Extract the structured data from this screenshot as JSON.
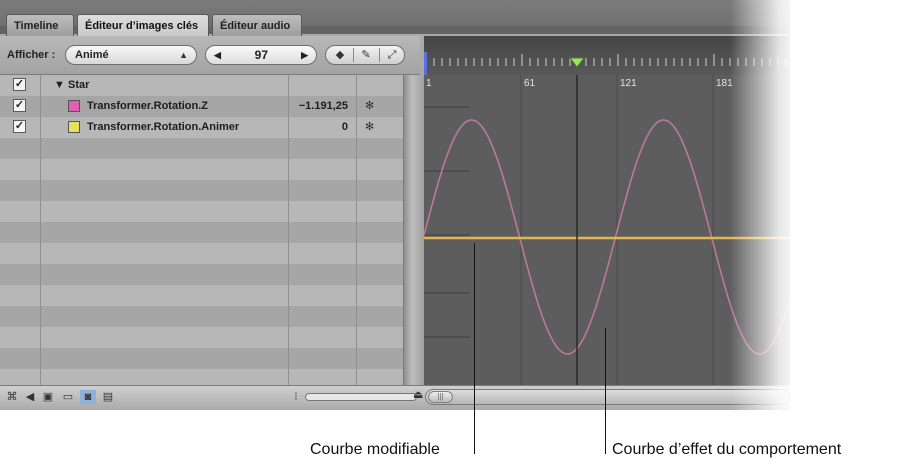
{
  "tabs": [
    {
      "label": "Timeline"
    },
    {
      "label": "Éditeur d’images clés"
    },
    {
      "label": "Éditeur audio"
    }
  ],
  "toolbar": {
    "show_label": "Afficher :",
    "show_value": "Animé",
    "current_frame": "97"
  },
  "list": {
    "rows": [
      {
        "label": "Star",
        "checked": true,
        "group": true
      },
      {
        "label": "Transformer.Rotation.Z",
        "value": "−1.191,25",
        "color": "#e25fb7",
        "checked": true
      },
      {
        "label": "Transformer.Rotation.Animer",
        "value": "0",
        "color": "#e6e05b",
        "checked": true
      }
    ]
  },
  "ruler": {
    "labels": [
      "1",
      "61",
      "121",
      "181"
    ],
    "playhead_frame": 97,
    "frame_range": [
      1,
      210
    ]
  },
  "curves": {
    "rotation_color": "#c07a9a",
    "animate_color": "#e2b64f"
  },
  "callouts": {
    "editable": "Courbe modifiable",
    "behavior": "Courbe d’effet du comportement"
  }
}
